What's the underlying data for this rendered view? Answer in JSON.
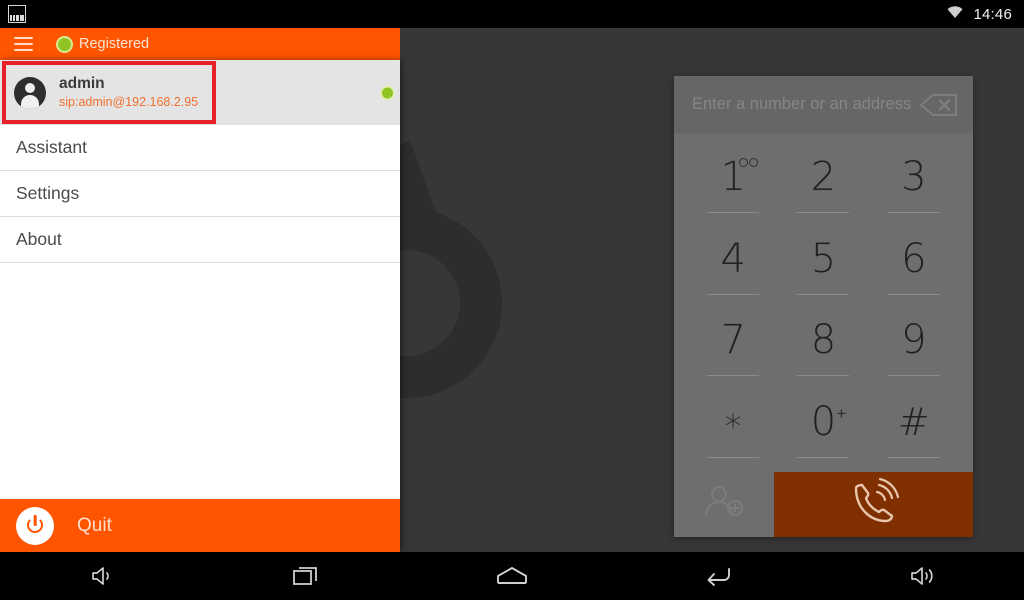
{
  "statusbar": {
    "screenshot_icon": "screenshot-icon",
    "wifi_icon": "wifi-icon",
    "clock": "14:46"
  },
  "appbar": {
    "menu_icon": "hamburger-menu-icon",
    "status_dot_icon": "registration-status-dot",
    "status_text": "Registered",
    "background_color": "#ff5400"
  },
  "sidebar": {
    "account": {
      "avatar_icon": "user-avatar-icon",
      "name": "admin",
      "sip_address": "sip:admin@192.168.2.95",
      "online_dot_icon": "online-status-dot",
      "highlighted": true,
      "highlight_color": "#e8202a"
    },
    "items": [
      {
        "label": "Assistant"
      },
      {
        "label": "Settings"
      },
      {
        "label": "About"
      }
    ],
    "quit": {
      "icon": "power-icon",
      "label": "Quit"
    }
  },
  "dialer": {
    "input": {
      "value": "",
      "placeholder": "Enter a number or an address"
    },
    "erase_icon": "backspace-erase-icon",
    "keys": [
      {
        "glyph": "1",
        "sup": "voicemail",
        "name": "dialpad-key-1"
      },
      {
        "glyph": "2",
        "sup": "",
        "name": "dialpad-key-2"
      },
      {
        "glyph": "3",
        "sup": "",
        "name": "dialpad-key-3"
      },
      {
        "glyph": "4",
        "sup": "",
        "name": "dialpad-key-4"
      },
      {
        "glyph": "5",
        "sup": "",
        "name": "dialpad-key-5"
      },
      {
        "glyph": "6",
        "sup": "",
        "name": "dialpad-key-6"
      },
      {
        "glyph": "7",
        "sup": "",
        "name": "dialpad-key-7"
      },
      {
        "glyph": "8",
        "sup": "",
        "name": "dialpad-key-8"
      },
      {
        "glyph": "9",
        "sup": "",
        "name": "dialpad-key-9"
      },
      {
        "glyph": "*",
        "sup": "",
        "name": "dialpad-key-star"
      },
      {
        "glyph": "0",
        "sup": "+",
        "name": "dialpad-key-0"
      },
      {
        "glyph": "#",
        "sup": "",
        "name": "dialpad-key-hash"
      }
    ],
    "add_contact_icon": "add-contact-icon",
    "call_icon": "call-phone-icon",
    "call_button_color": "#803000"
  },
  "navbar": {
    "buttons": [
      {
        "icon": "volume-down-icon"
      },
      {
        "icon": "recent-apps-icon"
      },
      {
        "icon": "home-icon"
      },
      {
        "icon": "back-icon"
      },
      {
        "icon": "volume-up-icon"
      }
    ]
  },
  "desktop": {
    "watermark_icon": "linphone-logo-watermark",
    "background_color": "#373737"
  }
}
